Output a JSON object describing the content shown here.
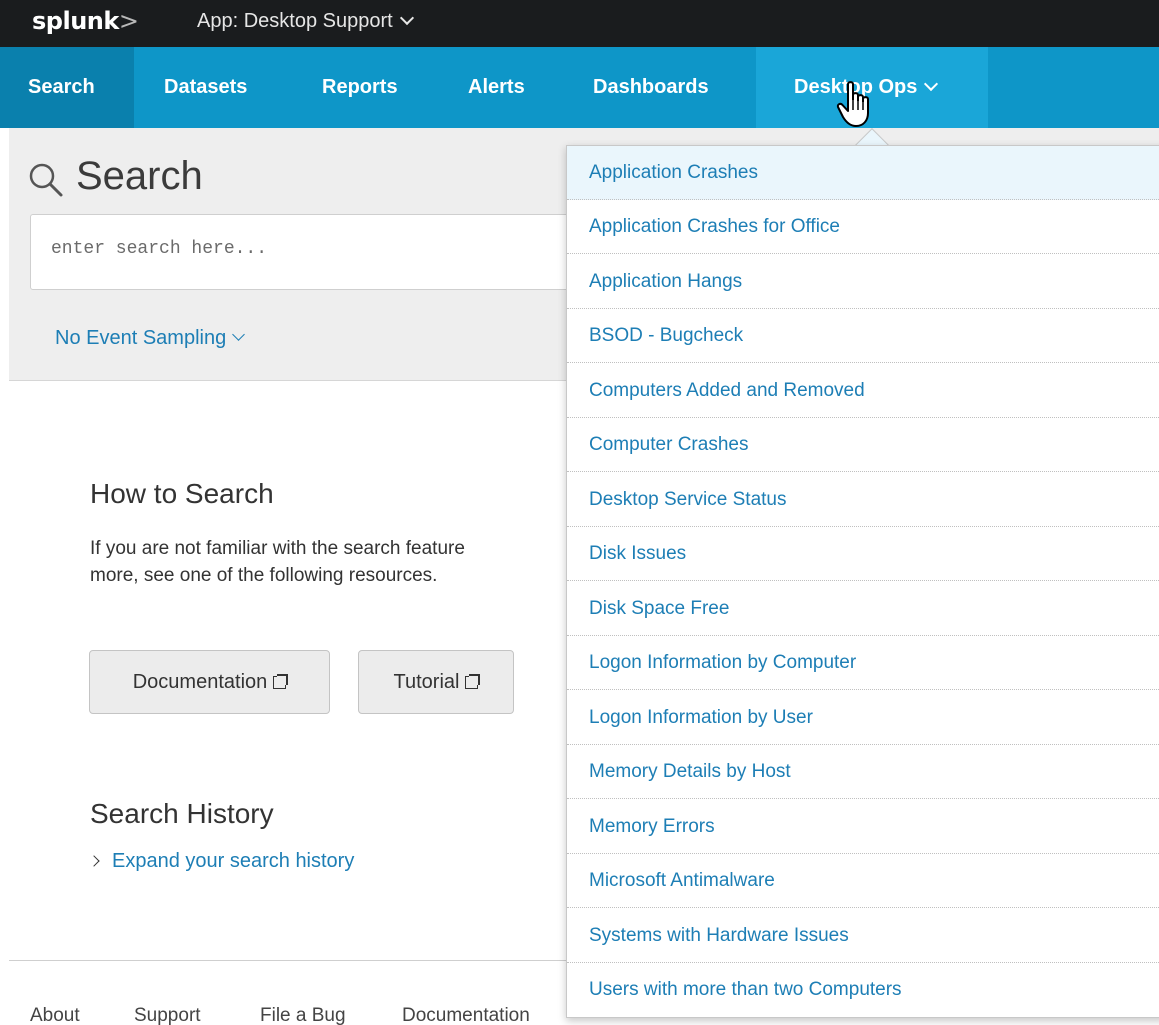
{
  "topbar": {
    "logo_main": "splunk",
    "logo_suffix": ">",
    "app_menu": "App: Desktop Support"
  },
  "nav": {
    "items": [
      {
        "label": "Search"
      },
      {
        "label": "Datasets"
      },
      {
        "label": "Reports"
      },
      {
        "label": "Alerts"
      },
      {
        "label": "Dashboards"
      },
      {
        "label": "Desktop Ops"
      }
    ]
  },
  "search": {
    "title": "Search",
    "placeholder": "enter search here...",
    "sampling": "No Event Sampling"
  },
  "help": {
    "heading": "How to Search",
    "line1": "If you are not familiar with the search feature",
    "line2": "more, see one of the following resources.",
    "documentation_button": "Documentation",
    "tutorial_button": "Tutorial"
  },
  "history": {
    "heading": "Search History",
    "expand": "Expand your search history"
  },
  "footer": {
    "links": [
      "About",
      "Support",
      "File a Bug",
      "Documentation"
    ]
  },
  "dropdown": {
    "items": [
      "Application Crashes",
      "Application Crashes for Office",
      "Application Hangs",
      "BSOD - Bugcheck",
      "Computers Added and Removed",
      "Computer Crashes",
      "Desktop Service Status",
      "Disk Issues",
      "Disk Space Free",
      "Logon Information by Computer",
      "Logon Information by User",
      "Memory Details by Host",
      "Memory Errors",
      "Microsoft Antimalware",
      "Systems with Hardware Issues",
      "Users with more than two Computers"
    ]
  },
  "colors": {
    "topbar": "#1a1c1e",
    "navbar": "#0e96c8",
    "link": "#1d7eb5",
    "hover_row": "#eaf6fc"
  }
}
